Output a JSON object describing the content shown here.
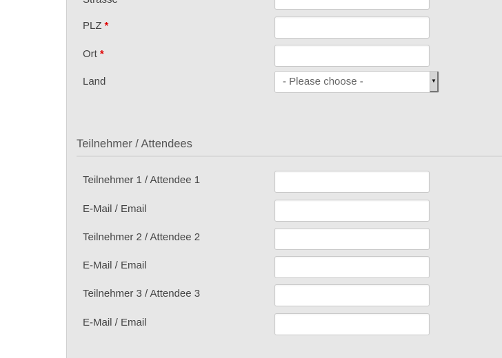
{
  "address": {
    "street_label": "Strasse",
    "fields": [
      {
        "label": "PLZ",
        "required": true,
        "required_mark": "*",
        "value": ""
      },
      {
        "label": "Ort",
        "required": true,
        "required_mark": "*",
        "value": ""
      }
    ],
    "country": {
      "label": "Land",
      "selected": "- Please choose -",
      "arrow_icon": "▼"
    }
  },
  "attendees": {
    "title": "Teilnehmer / Attendees",
    "fields": [
      {
        "label": "Teilnehmer 1 / Attendee 1",
        "value": ""
      },
      {
        "label": "E-Mail / Email",
        "value": ""
      },
      {
        "label": "Teilnehmer 2 / Attendee 2",
        "value": ""
      },
      {
        "label": "E-Mail / Email",
        "value": ""
      },
      {
        "label": "Teilnehmer 3 / Attendee 3",
        "value": ""
      },
      {
        "label": "E-Mail / Email",
        "value": ""
      }
    ]
  }
}
